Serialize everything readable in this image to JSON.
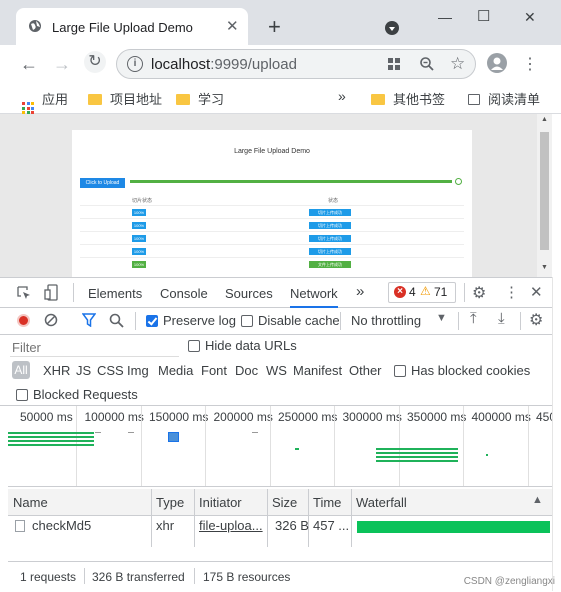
{
  "browser": {
    "tab_title": "Large File Upload Demo",
    "tab_close": "✕",
    "new_tab": "+",
    "url_host": "localhost",
    "url_rest": ":9999/upload",
    "window_controls": {
      "minimize": "—",
      "maximize": "☐",
      "close": "✕"
    }
  },
  "bookmarks": {
    "apps": "应用",
    "items": [
      "项目地址",
      "学习"
    ],
    "more": "»",
    "other": "其他书签",
    "reading_list": "阅读清单"
  },
  "page": {
    "title": "Large File Upload Demo",
    "upload_button": "Click to Upload",
    "col_progress": "切片状态",
    "col_status": "状态",
    "rows": [
      {
        "chip": "100%",
        "status": "切片上传成功"
      },
      {
        "chip": "100%",
        "status": "切片上传成功"
      },
      {
        "chip": "100%",
        "status": "切片上传成功"
      },
      {
        "chip": "100%",
        "status": "切片上传成功"
      },
      {
        "chip": "100%",
        "status": "文件上传成功"
      }
    ],
    "progress": 1.0
  },
  "devtools": {
    "tabs": [
      "Elements",
      "Console",
      "Sources",
      "Network"
    ],
    "active_tab": "Network",
    "more_tabs": "»",
    "errors": "4",
    "warnings": "71",
    "preserve_log": "Preserve log",
    "disable_cache": "Disable cache",
    "throttling": "No throttling",
    "filter_placeholder": "Filter",
    "hide_data_urls": "Hide data URLs",
    "types": [
      "All",
      "XHR",
      "JS",
      "CSS",
      "Img",
      "Media",
      "Font",
      "Doc",
      "WS",
      "Manifest",
      "Other"
    ],
    "has_blocked_cookies": "Has blocked cookies",
    "blocked_requests": "Blocked Requests",
    "timeline_ticks": [
      "50000 ms",
      "100000 ms",
      "150000 ms",
      "200000 ms",
      "250000 ms",
      "300000 ms",
      "350000 ms",
      "400000 ms",
      "450"
    ],
    "columns": [
      "Name",
      "Type",
      "Initiator",
      "Size",
      "Time",
      "Waterfall"
    ],
    "rows": [
      {
        "name": "checkMd5",
        "type": "xhr",
        "initiator": "file-uploa...",
        "size": "326 B",
        "time": "457 ..."
      }
    ],
    "status": {
      "requests": "1 requests",
      "transferred": "326 B transferred",
      "resources": "175 B resources"
    }
  },
  "watermark": "CSDN @zengliangxi"
}
